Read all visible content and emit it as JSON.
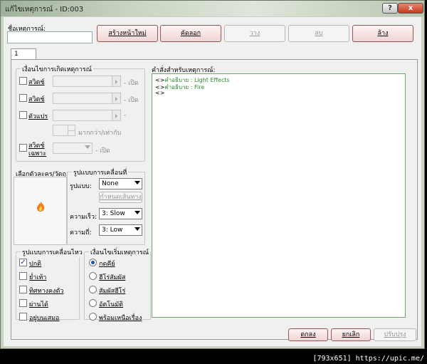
{
  "window": {
    "title": "แก้ไขเหตุการณ์ - ID:003",
    "help_label": "?",
    "close_label": "x"
  },
  "header": {
    "event_name_label": "ชื่อเหตุการณ์:",
    "event_name_value": "",
    "buttons": {
      "new_page": "สร้างหน้าใหม่",
      "copy": "คัดลอก",
      "paste": "วาง",
      "delete": "ลบ",
      "clear": "ล้าง"
    }
  },
  "tabs": [
    {
      "label": "1"
    }
  ],
  "conditions": {
    "title": "เงื่อนไขการเกิดเหตุการณ์",
    "switch1_label": "สวิตช์",
    "switch1_suffix": "- เปิด",
    "switch2_label": "สวิตช์",
    "switch2_suffix": "- เปิด",
    "variable_label": "ตัวแปร",
    "variable_suffix": "-",
    "variable_compare": "มากกว่า/เท่ากับ",
    "self_switch_label_line1": "สวิตช์",
    "self_switch_label_line2": "เฉพาะ",
    "self_switch_suffix": "- เปิด"
  },
  "graphic": {
    "title": "เลือกตัวละคร/วัตถุ:"
  },
  "movement": {
    "title": "รูปแบบการเคลื่อนที่",
    "type_label": "รูปแบบ:",
    "type_value": "None",
    "route_button": "กำหนดเส้นทาง",
    "speed_label": "ความเร็ว:",
    "speed_value": "3: Slow",
    "frequency_label": "ความถี่:",
    "frequency_value": "3: Low"
  },
  "options": {
    "title": "รูปแบบการเคลื่อนไหว",
    "items": [
      {
        "label": "ปกติ",
        "checked": true
      },
      {
        "label": "ย่ำเท้า",
        "checked": false
      },
      {
        "label": "ทิศทางคงตัว",
        "checked": false
      },
      {
        "label": "ผ่านได้",
        "checked": false
      },
      {
        "label": "อยู่บนเสมอ",
        "checked": false
      }
    ]
  },
  "trigger": {
    "title": "เงื่อนไขเริ่มเหตุการณ์",
    "items": [
      {
        "label": "กดคีย์",
        "selected": true
      },
      {
        "label": "ฮีโร่สัมผัส",
        "selected": false
      },
      {
        "label": "สัมผัสฮีโร่",
        "selected": false
      },
      {
        "label": "อัตโนมัติ",
        "selected": false
      },
      {
        "label": "พร้อมเหนือเรื่อง",
        "selected": false
      }
    ]
  },
  "commands": {
    "title": "คำสั่งสำหรับเหตุการณ์:",
    "lines": [
      {
        "prefix": "<>",
        "text": "คำอธิบาย : Light Effects"
      },
      {
        "prefix": "<>",
        "text": "คำอธิบาย : Fire"
      },
      {
        "prefix": "<>",
        "text": ""
      }
    ]
  },
  "footer": {
    "ok": "ตกลง",
    "cancel": "ยกเลิก",
    "apply": "ปรับปรุง"
  },
  "watermark": "[793x651] https://upic.me/",
  "colors": {
    "command_text": "#2e8b2e",
    "close_button": "#c23b1f",
    "list_border": "#6fa86f"
  }
}
